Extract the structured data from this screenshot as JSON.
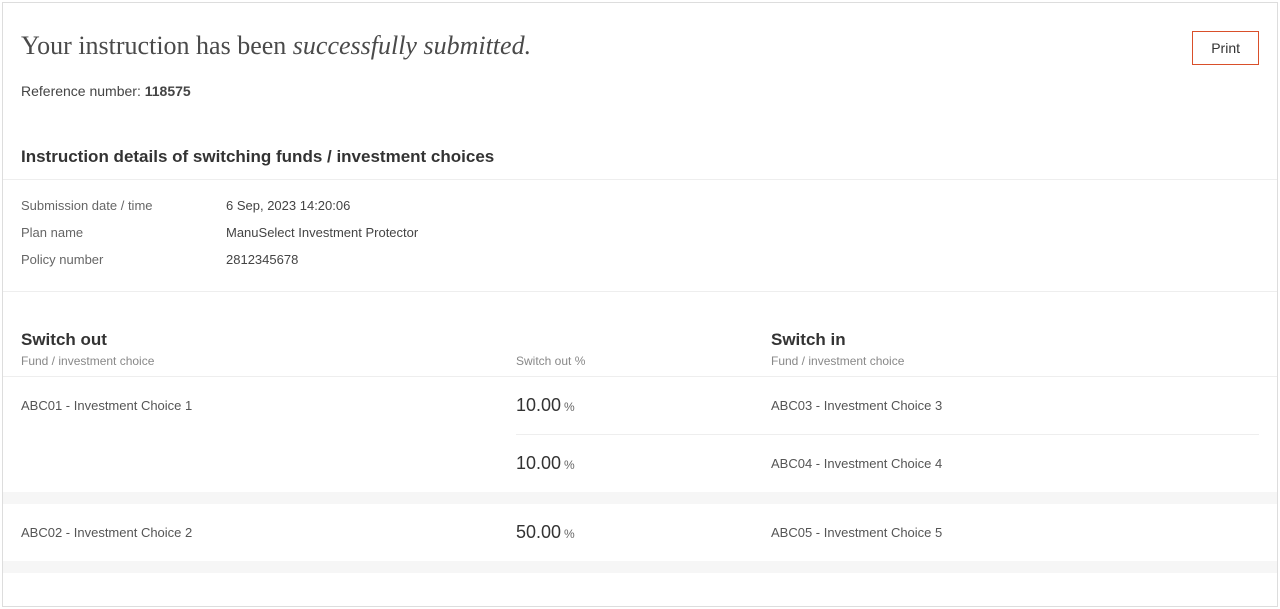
{
  "header": {
    "title_prefix": "Your instruction has been ",
    "title_italic": "successfully submitted.",
    "print_label": "Print"
  },
  "reference": {
    "label": "Reference number: ",
    "value": "118575"
  },
  "section_title": "Instruction details of switching funds / investment choices",
  "details": {
    "submission_label": "Submission date / time",
    "submission_value": "6 Sep, 2023 14:20:06",
    "plan_label": "Plan name",
    "plan_value": "ManuSelect Investment Protector",
    "policy_label": "Policy number",
    "policy_value": "2812345678"
  },
  "switch_headers": {
    "out_title": "Switch out",
    "out_sub": "Fund / investment choice",
    "pct_label": "Switch out %",
    "in_title": "Switch in",
    "in_sub": "Fund / investment choice"
  },
  "groups": [
    {
      "out_fund": "ABC01 - Investment Choice 1",
      "rows": [
        {
          "pct": "10.00",
          "pct_sym": "%",
          "in_fund": "ABC03 - Investment Choice 3"
        },
        {
          "pct": "10.00",
          "pct_sym": "%",
          "in_fund": "ABC04 - Investment Choice 4"
        }
      ]
    },
    {
      "out_fund": "ABC02 - Investment Choice 2",
      "rows": [
        {
          "pct": "50.00",
          "pct_sym": "%",
          "in_fund": "ABC05 - Investment Choice 5"
        }
      ]
    }
  ]
}
